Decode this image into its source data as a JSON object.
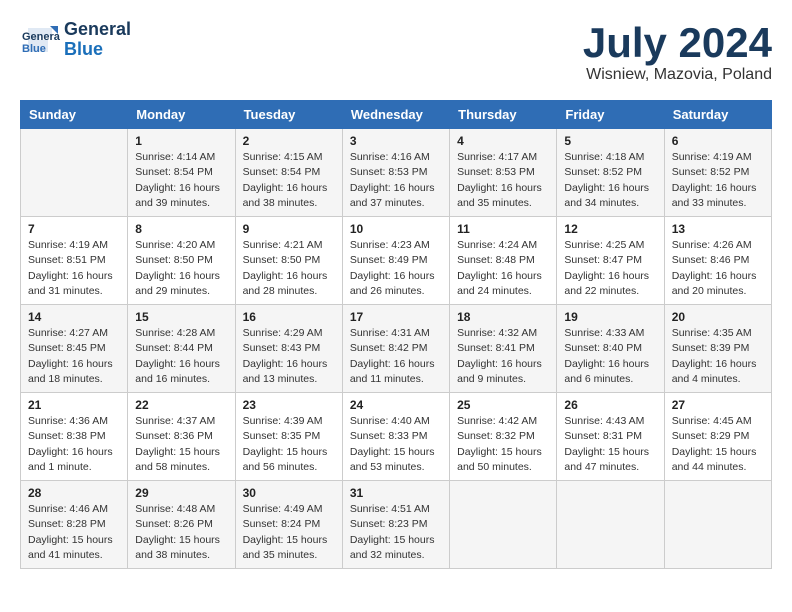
{
  "header": {
    "logo_line1": "General",
    "logo_line2": "Blue",
    "month_title": "July 2024",
    "location": "Wisniew, Mazovia, Poland"
  },
  "weekdays": [
    "Sunday",
    "Monday",
    "Tuesday",
    "Wednesday",
    "Thursday",
    "Friday",
    "Saturday"
  ],
  "weeks": [
    [
      {
        "day": "",
        "detail": ""
      },
      {
        "day": "1",
        "detail": "Sunrise: 4:14 AM\nSunset: 8:54 PM\nDaylight: 16 hours\nand 39 minutes."
      },
      {
        "day": "2",
        "detail": "Sunrise: 4:15 AM\nSunset: 8:54 PM\nDaylight: 16 hours\nand 38 minutes."
      },
      {
        "day": "3",
        "detail": "Sunrise: 4:16 AM\nSunset: 8:53 PM\nDaylight: 16 hours\nand 37 minutes."
      },
      {
        "day": "4",
        "detail": "Sunrise: 4:17 AM\nSunset: 8:53 PM\nDaylight: 16 hours\nand 35 minutes."
      },
      {
        "day": "5",
        "detail": "Sunrise: 4:18 AM\nSunset: 8:52 PM\nDaylight: 16 hours\nand 34 minutes."
      },
      {
        "day": "6",
        "detail": "Sunrise: 4:19 AM\nSunset: 8:52 PM\nDaylight: 16 hours\nand 33 minutes."
      }
    ],
    [
      {
        "day": "7",
        "detail": "Sunrise: 4:19 AM\nSunset: 8:51 PM\nDaylight: 16 hours\nand 31 minutes."
      },
      {
        "day": "8",
        "detail": "Sunrise: 4:20 AM\nSunset: 8:50 PM\nDaylight: 16 hours\nand 29 minutes."
      },
      {
        "day": "9",
        "detail": "Sunrise: 4:21 AM\nSunset: 8:50 PM\nDaylight: 16 hours\nand 28 minutes."
      },
      {
        "day": "10",
        "detail": "Sunrise: 4:23 AM\nSunset: 8:49 PM\nDaylight: 16 hours\nand 26 minutes."
      },
      {
        "day": "11",
        "detail": "Sunrise: 4:24 AM\nSunset: 8:48 PM\nDaylight: 16 hours\nand 24 minutes."
      },
      {
        "day": "12",
        "detail": "Sunrise: 4:25 AM\nSunset: 8:47 PM\nDaylight: 16 hours\nand 22 minutes."
      },
      {
        "day": "13",
        "detail": "Sunrise: 4:26 AM\nSunset: 8:46 PM\nDaylight: 16 hours\nand 20 minutes."
      }
    ],
    [
      {
        "day": "14",
        "detail": "Sunrise: 4:27 AM\nSunset: 8:45 PM\nDaylight: 16 hours\nand 18 minutes."
      },
      {
        "day": "15",
        "detail": "Sunrise: 4:28 AM\nSunset: 8:44 PM\nDaylight: 16 hours\nand 16 minutes."
      },
      {
        "day": "16",
        "detail": "Sunrise: 4:29 AM\nSunset: 8:43 PM\nDaylight: 16 hours\nand 13 minutes."
      },
      {
        "day": "17",
        "detail": "Sunrise: 4:31 AM\nSunset: 8:42 PM\nDaylight: 16 hours\nand 11 minutes."
      },
      {
        "day": "18",
        "detail": "Sunrise: 4:32 AM\nSunset: 8:41 PM\nDaylight: 16 hours\nand 9 minutes."
      },
      {
        "day": "19",
        "detail": "Sunrise: 4:33 AM\nSunset: 8:40 PM\nDaylight: 16 hours\nand 6 minutes."
      },
      {
        "day": "20",
        "detail": "Sunrise: 4:35 AM\nSunset: 8:39 PM\nDaylight: 16 hours\nand 4 minutes."
      }
    ],
    [
      {
        "day": "21",
        "detail": "Sunrise: 4:36 AM\nSunset: 8:38 PM\nDaylight: 16 hours\nand 1 minute."
      },
      {
        "day": "22",
        "detail": "Sunrise: 4:37 AM\nSunset: 8:36 PM\nDaylight: 15 hours\nand 58 minutes."
      },
      {
        "day": "23",
        "detail": "Sunrise: 4:39 AM\nSunset: 8:35 PM\nDaylight: 15 hours\nand 56 minutes."
      },
      {
        "day": "24",
        "detail": "Sunrise: 4:40 AM\nSunset: 8:33 PM\nDaylight: 15 hours\nand 53 minutes."
      },
      {
        "day": "25",
        "detail": "Sunrise: 4:42 AM\nSunset: 8:32 PM\nDaylight: 15 hours\nand 50 minutes."
      },
      {
        "day": "26",
        "detail": "Sunrise: 4:43 AM\nSunset: 8:31 PM\nDaylight: 15 hours\nand 47 minutes."
      },
      {
        "day": "27",
        "detail": "Sunrise: 4:45 AM\nSunset: 8:29 PM\nDaylight: 15 hours\nand 44 minutes."
      }
    ],
    [
      {
        "day": "28",
        "detail": "Sunrise: 4:46 AM\nSunset: 8:28 PM\nDaylight: 15 hours\nand 41 minutes."
      },
      {
        "day": "29",
        "detail": "Sunrise: 4:48 AM\nSunset: 8:26 PM\nDaylight: 15 hours\nand 38 minutes."
      },
      {
        "day": "30",
        "detail": "Sunrise: 4:49 AM\nSunset: 8:24 PM\nDaylight: 15 hours\nand 35 minutes."
      },
      {
        "day": "31",
        "detail": "Sunrise: 4:51 AM\nSunset: 8:23 PM\nDaylight: 15 hours\nand 32 minutes."
      },
      {
        "day": "",
        "detail": ""
      },
      {
        "day": "",
        "detail": ""
      },
      {
        "day": "",
        "detail": ""
      }
    ]
  ]
}
